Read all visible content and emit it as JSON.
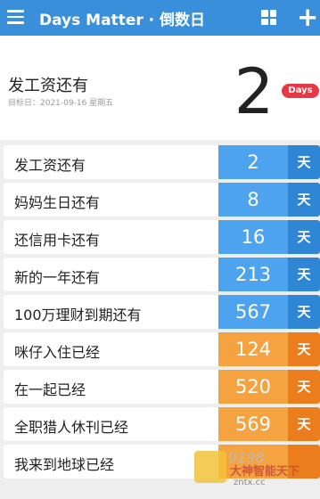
{
  "header": {
    "title": "Days Matter · 倒数日",
    "menu_icon": "menu-icon",
    "grid_icon": "grid-view-icon",
    "add_label": "+",
    "color": "#3a8fdb"
  },
  "hero": {
    "title": "发工资还有",
    "target_date": "目标日：2021-09-16 星期五",
    "count": "2",
    "unit": "Days",
    "unit_color": "#e63946"
  },
  "events": [
    {
      "label": "发工资还有",
      "count": "2",
      "unit": "天",
      "kind": "countdown"
    },
    {
      "label": "妈妈生日还有",
      "count": "8",
      "unit": "天",
      "kind": "countdown"
    },
    {
      "label": "还信用卡还有",
      "count": "16",
      "unit": "天",
      "kind": "countdown"
    },
    {
      "label": "新的一年还有",
      "count": "213",
      "unit": "天",
      "kind": "countdown"
    },
    {
      "label": "100万理财到期还有",
      "count": "567",
      "unit": "天",
      "kind": "countdown"
    },
    {
      "label": "咪仔入住已经",
      "count": "124",
      "unit": "天",
      "kind": "elapsed"
    },
    {
      "label": "在一起已经",
      "count": "520",
      "unit": "天",
      "kind": "elapsed"
    },
    {
      "label": "全职猎人休刊已经",
      "count": "569",
      "unit": "天",
      "kind": "elapsed"
    },
    {
      "label": "我来到地球已经",
      "count": "",
      "unit": "",
      "kind": "elapsed"
    }
  ],
  "colors": {
    "countdown": "#4da3ee",
    "elapsed": "#f5a341"
  },
  "watermark": {
    "number": "9198",
    "name": "大神智能天下",
    "url": "zntx.cc"
  }
}
